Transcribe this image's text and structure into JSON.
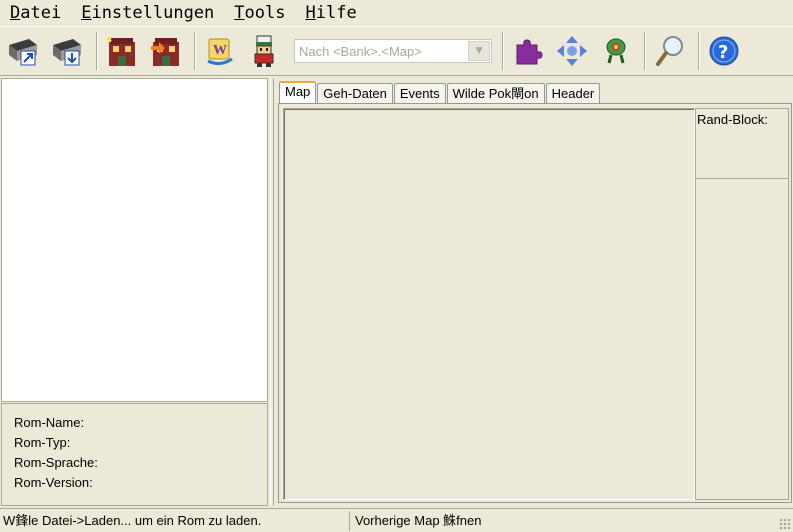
{
  "menu": [
    {
      "first": "D",
      "rest": "atei"
    },
    {
      "first": "E",
      "rest": "instellungen"
    },
    {
      "first": "T",
      "rest": "ools"
    },
    {
      "first": "H",
      "rest": "ilfe"
    }
  ],
  "toolbar": {
    "combo_placeholder": "Nach <Bank>.<Map>",
    "icons": [
      "open-rom-icon",
      "save-rom-icon",
      "new-map-icon",
      "import-map-icon",
      "script-editor-icon",
      "trainer-icon",
      "puzzle-icon",
      "move-icon",
      "pokemon-icon",
      "search-icon",
      "help-icon"
    ]
  },
  "info": {
    "rom_name": "Rom-Name:",
    "rom_typ": "Rom-Typ:",
    "rom_sprache": "Rom-Sprache:",
    "rom_version": "Rom-Version:"
  },
  "tabs": [
    "Map",
    "Geh-Daten",
    "Events",
    "Wilde Pok閘on",
    "Header"
  ],
  "panel": {
    "rand_block": "Rand-Block:"
  },
  "status": {
    "left": "W鋒le Datei->Laden... um ein Rom zu laden.",
    "right": "Vorherige Map 鮢fnen"
  }
}
